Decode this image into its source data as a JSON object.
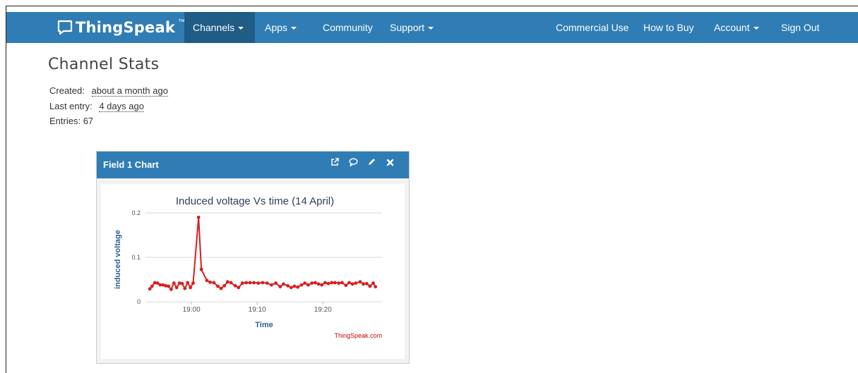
{
  "brand": {
    "name": "ThingSpeak",
    "tm": "™"
  },
  "nav": {
    "channels": "Channels",
    "apps": "Apps",
    "community": "Community",
    "support": "Support",
    "commercial": "Commercial Use",
    "how_to_buy": "How to Buy",
    "account": "Account",
    "sign_out": "Sign Out"
  },
  "stats": {
    "title": "Channel Stats",
    "created_label": "Created:",
    "created_value": "about a month ago",
    "last_entry_label": "Last entry:",
    "last_entry_value": "4 days ago",
    "entries_label": "Entries:",
    "entries_value": "67"
  },
  "panel": {
    "title": "Field 1 Chart",
    "icons": [
      "external-link-icon",
      "comment-icon",
      "pencil-icon",
      "close-icon"
    ]
  },
  "colors": {
    "nav": "#2f7db4",
    "nav_active": "#1f5c86",
    "series": "#d62020",
    "axis_title": "#2f5f96"
  },
  "chart_data": {
    "type": "line",
    "title": "Induced voltage Vs time (14 April)",
    "xlabel": "Time",
    "ylabel": "induced voltage",
    "credit": "ThingSpeak.com",
    "x_ticks": [
      "19:00",
      "19:10",
      "19:20"
    ],
    "y_ticks": [
      "0",
      "0.1",
      "0.2"
    ],
    "ylim": [
      0,
      0.2
    ],
    "xlim_minutes": [
      "18:53",
      "19:29"
    ],
    "grid": true,
    "series": [
      {
        "x": [
          "18:53:40",
          "18:54:00",
          "18:54:25",
          "18:54:50",
          "18:55:15",
          "18:55:40",
          "18:56:05",
          "18:56:30",
          "18:56:55",
          "18:57:20",
          "18:57:45",
          "18:58:10",
          "18:58:35",
          "18:59:00",
          "18:59:25",
          "18:59:50",
          "19:00:15",
          "19:01:05",
          "19:01:30",
          "19:02:20",
          "19:02:50",
          "19:03:25",
          "19:04:00",
          "19:04:30",
          "19:05:00",
          "19:05:30",
          "19:06:00",
          "19:06:40",
          "19:07:10",
          "19:07:45",
          "19:08:20",
          "19:08:55",
          "19:09:30",
          "19:10:10",
          "19:10:50",
          "19:11:30",
          "19:12:10",
          "19:12:50",
          "19:13:30",
          "19:14:00",
          "19:14:40",
          "19:15:10",
          "19:15:40",
          "19:16:10",
          "19:16:45",
          "19:17:15",
          "19:17:45",
          "19:18:20",
          "19:18:50",
          "19:19:20",
          "19:19:50",
          "19:20:20",
          "19:20:50",
          "19:21:20",
          "19:21:50",
          "19:22:25",
          "19:22:55",
          "19:23:30",
          "19:24:00",
          "19:24:30",
          "19:25:00",
          "19:25:40",
          "19:26:10",
          "19:26:40",
          "19:27:10",
          "19:27:40",
          "19:28:00"
        ],
        "values": [
          0.029,
          0.035,
          0.043,
          0.042,
          0.038,
          0.038,
          0.036,
          0.035,
          0.028,
          0.042,
          0.032,
          0.042,
          0.041,
          0.03,
          0.043,
          0.032,
          0.042,
          0.19,
          0.073,
          0.048,
          0.044,
          0.043,
          0.035,
          0.03,
          0.036,
          0.045,
          0.043,
          0.036,
          0.032,
          0.042,
          0.043,
          0.043,
          0.043,
          0.042,
          0.043,
          0.042,
          0.038,
          0.042,
          0.034,
          0.04,
          0.036,
          0.032,
          0.035,
          0.033,
          0.038,
          0.042,
          0.038,
          0.042,
          0.043,
          0.04,
          0.038,
          0.043,
          0.041,
          0.043,
          0.043,
          0.042,
          0.043,
          0.037,
          0.043,
          0.04,
          0.042,
          0.045,
          0.04,
          0.041,
          0.035,
          0.042,
          0.034
        ]
      }
    ]
  }
}
